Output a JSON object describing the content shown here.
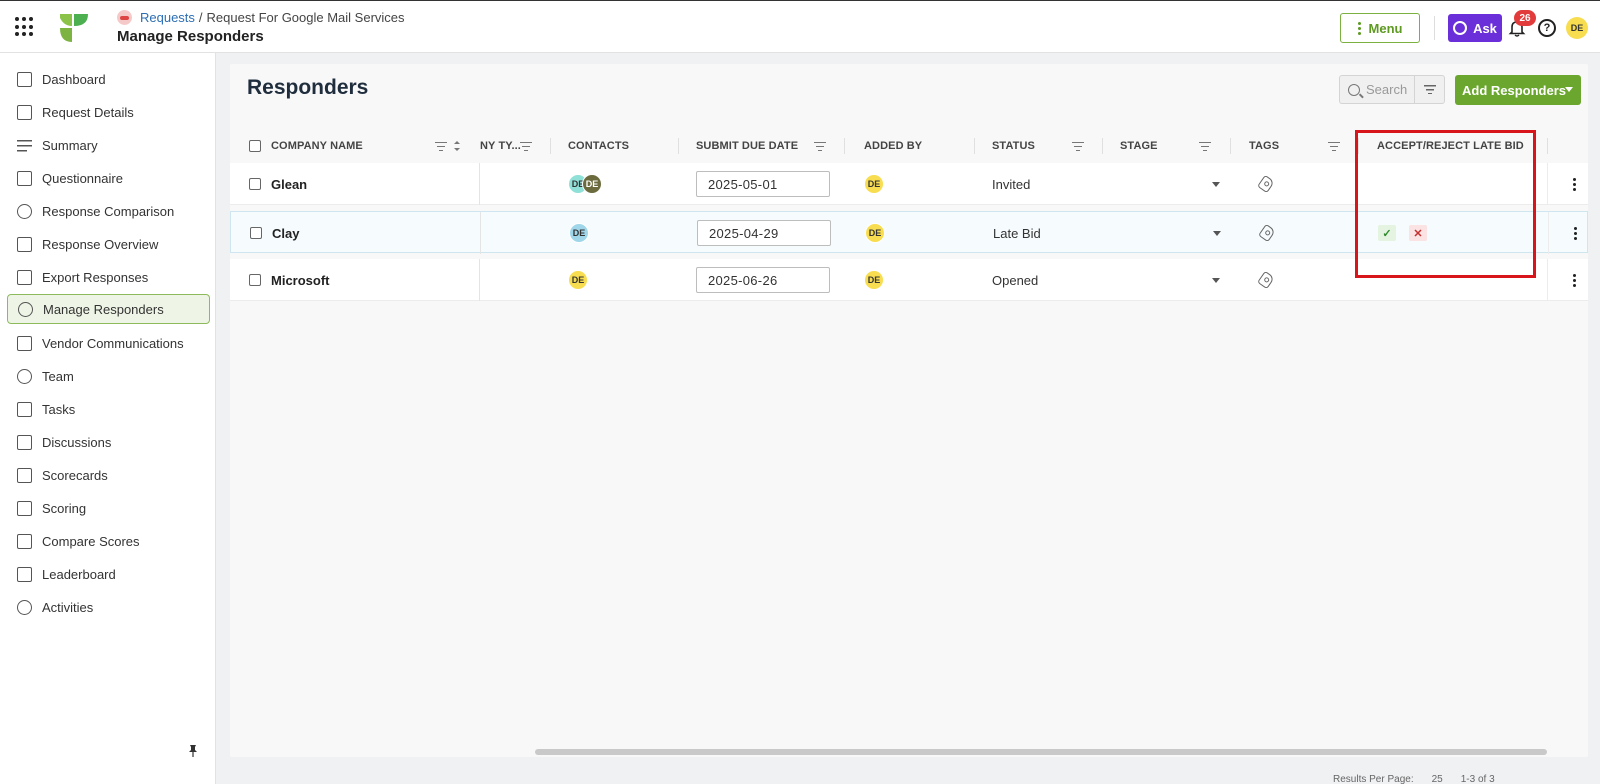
{
  "breadcrumb": {
    "root": "Requests",
    "separator": "/",
    "current": "Request For Google Mail Services"
  },
  "page_title": "Manage Responders",
  "header": {
    "menu_label": "Menu",
    "ask_label": "Ask",
    "notification_count": "26",
    "user_initials": "DE"
  },
  "sidebar": {
    "items": [
      {
        "label": "Dashboard",
        "icon": "dashboard-icon"
      },
      {
        "label": "Request Details",
        "icon": "document-icon"
      },
      {
        "label": "Summary",
        "icon": "list-icon"
      },
      {
        "label": "Questionnaire",
        "icon": "questionnaire-icon"
      },
      {
        "label": "Response Comparison",
        "icon": "comparison-icon"
      },
      {
        "label": "Response Overview",
        "icon": "overview-icon"
      },
      {
        "label": "Export Responses",
        "icon": "export-icon"
      },
      {
        "label": "Manage Responders",
        "icon": "responders-icon",
        "active": true
      },
      {
        "label": "Vendor Communications",
        "icon": "vendor-icon"
      },
      {
        "label": "Team",
        "icon": "team-icon"
      },
      {
        "label": "Tasks",
        "icon": "tasks-icon"
      },
      {
        "label": "Discussions",
        "icon": "discussions-icon"
      },
      {
        "label": "Scorecards",
        "icon": "scorecards-icon"
      },
      {
        "label": "Scoring",
        "icon": "scoring-icon"
      },
      {
        "label": "Compare Scores",
        "icon": "compare-icon"
      },
      {
        "label": "Leaderboard",
        "icon": "leaderboard-icon"
      },
      {
        "label": "Activities",
        "icon": "history-icon"
      }
    ]
  },
  "panel": {
    "title": "Responders",
    "search_placeholder": "Search",
    "add_button": "Add Responders"
  },
  "table": {
    "columns": {
      "company_name": "COMPANY NAME",
      "company_type": "NY TY...",
      "contacts": "CONTACTS",
      "submit_due_date": "SUBMIT DUE DATE",
      "added_by": "ADDED BY",
      "status": "STATUS",
      "stage": "STAGE",
      "tags": "TAGS",
      "accept_reject": "ACCEPT/REJECT LATE BID"
    },
    "rows": [
      {
        "company": "Glean",
        "contacts": [
          "DE",
          "DE"
        ],
        "due_date": "2025-05-01",
        "added_by": "DE",
        "status": "Invited",
        "late_bid_actions": false
      },
      {
        "company": "Clay",
        "contacts": [
          "DE"
        ],
        "due_date": "2025-04-29",
        "added_by": "DE",
        "status": "Late Bid",
        "late_bid_actions": true
      },
      {
        "company": "Microsoft",
        "contacts": [
          "DE"
        ],
        "due_date": "2025-06-26",
        "added_by": "DE",
        "status": "Opened",
        "late_bid_actions": false
      }
    ]
  },
  "footer": {
    "results_per_page_label": "Results Per Page:",
    "results_per_page": "25",
    "range": "1-3 of 3"
  },
  "colors": {
    "brand_green": "#6ba72f",
    "ask_purple": "#6a2fd8",
    "highlight_red": "#d7151a"
  }
}
